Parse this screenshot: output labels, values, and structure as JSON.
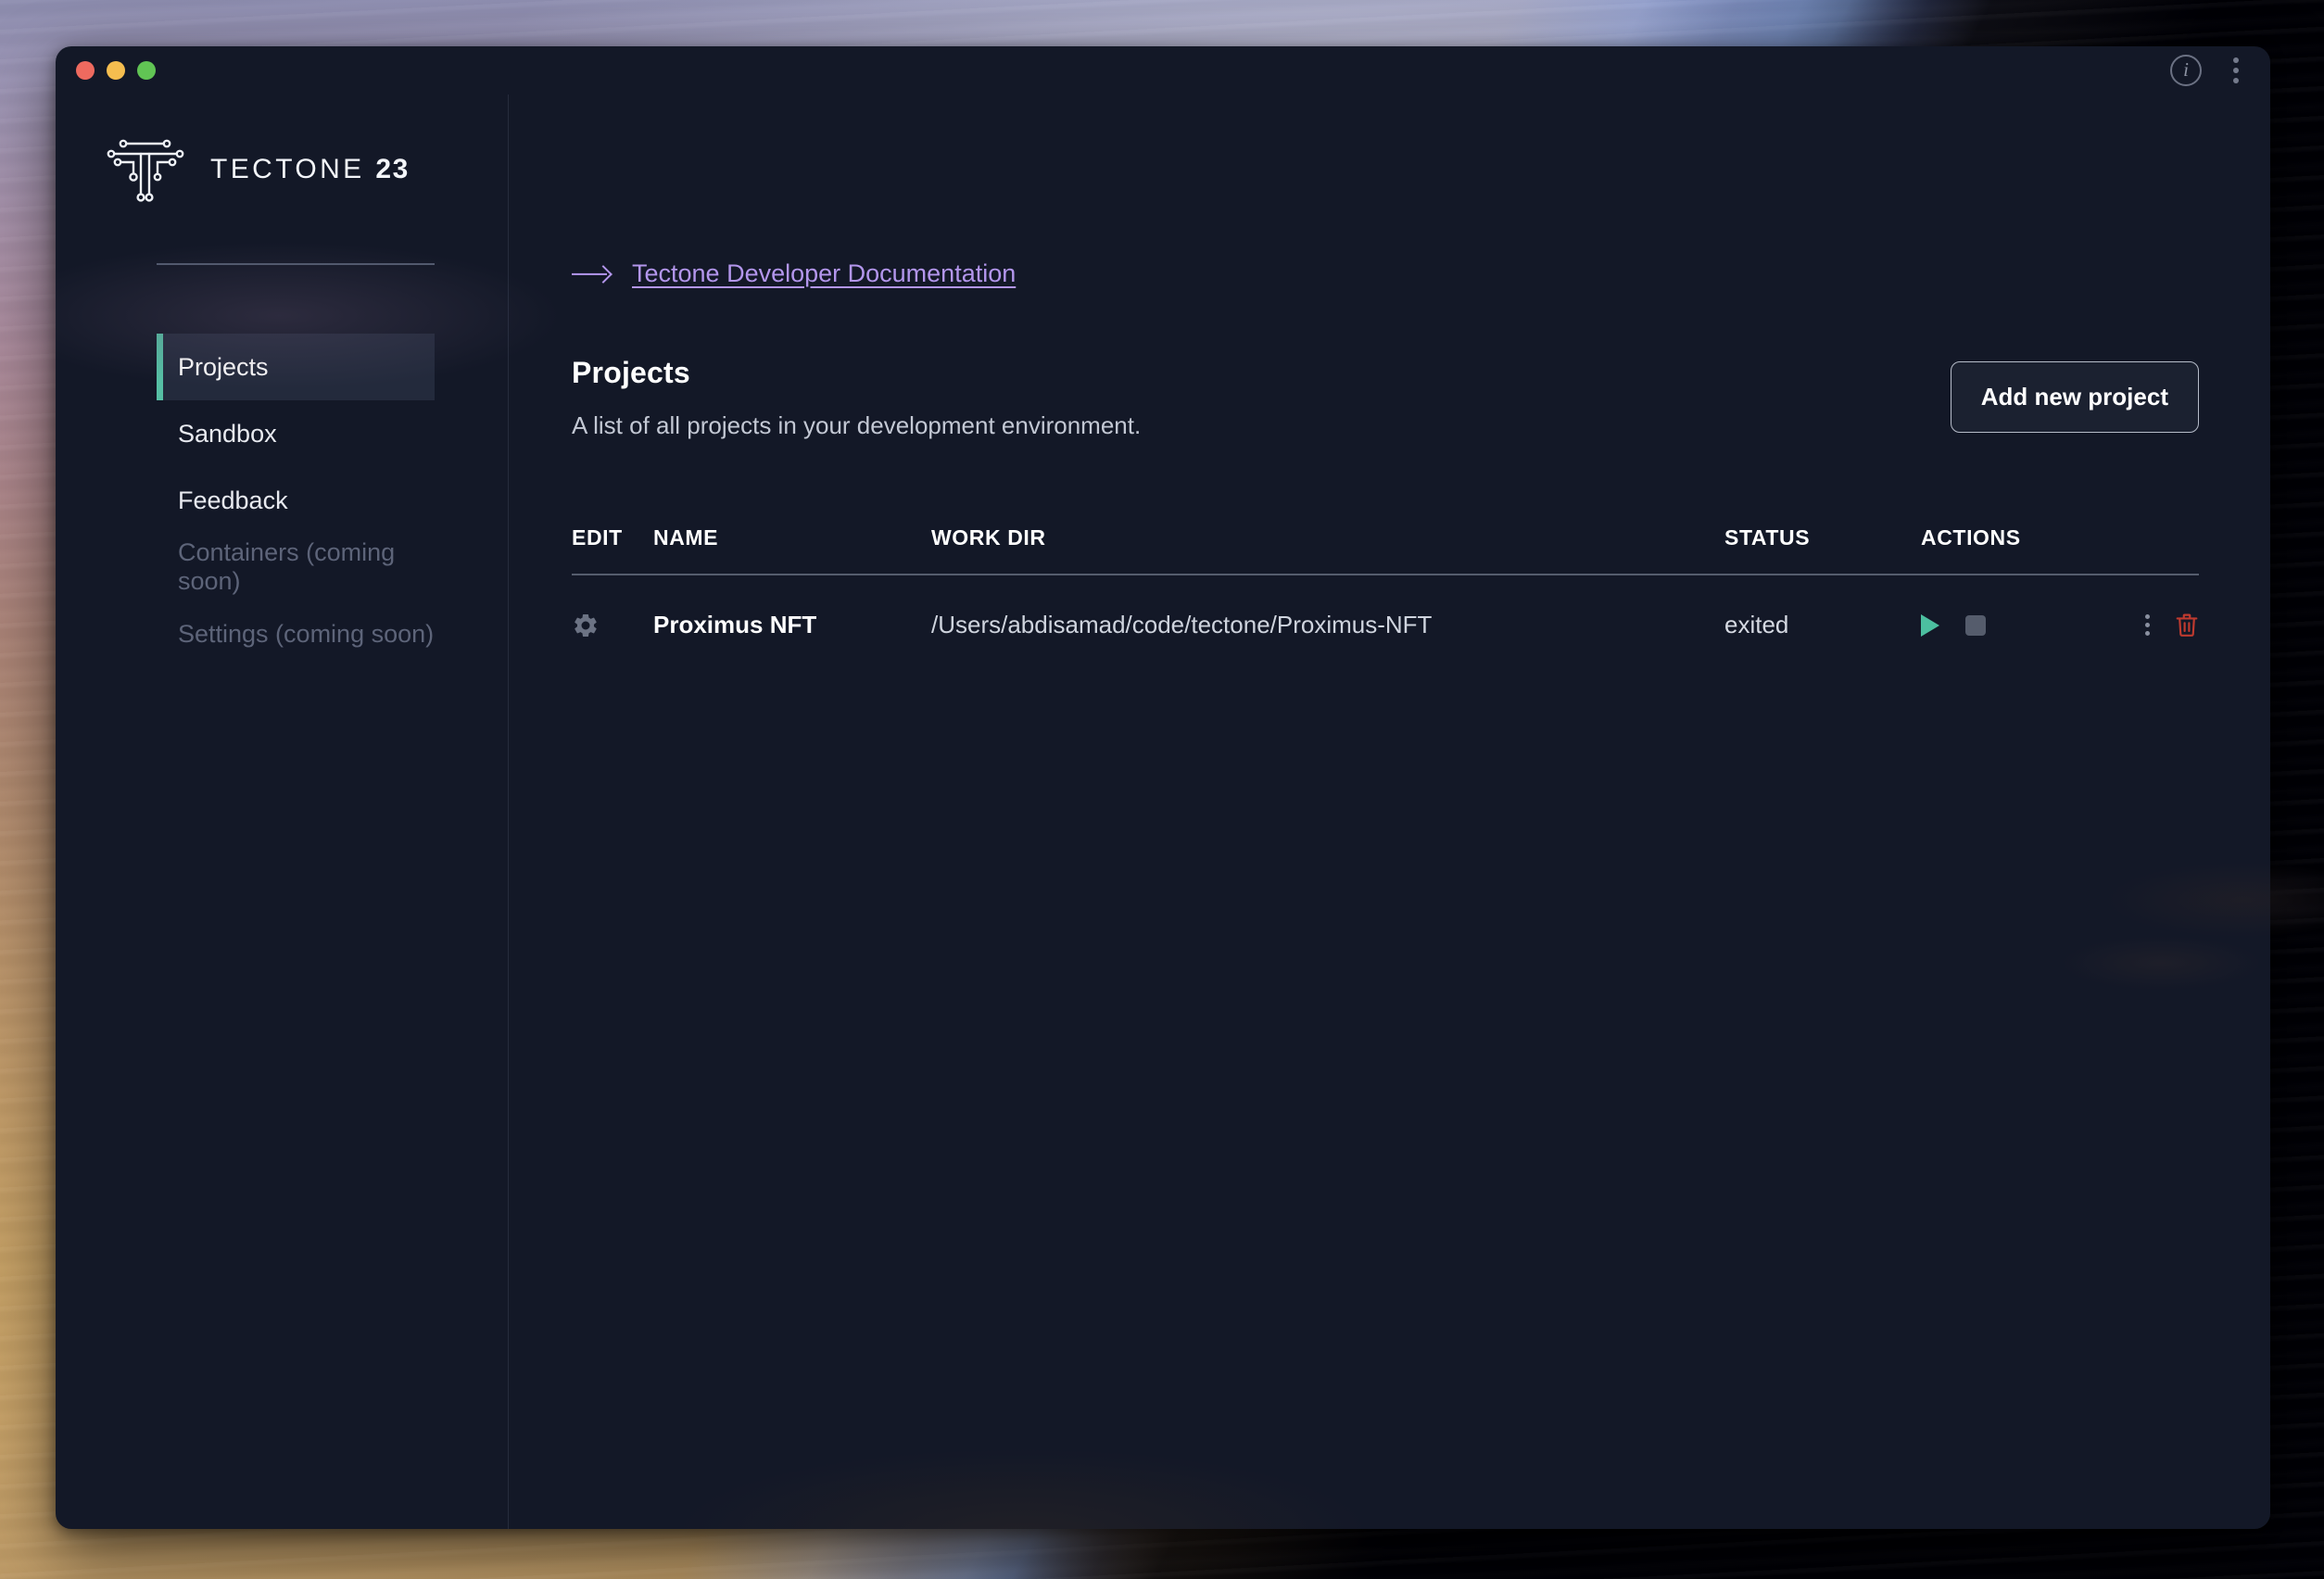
{
  "window": {
    "traffic_lights": [
      "close",
      "minimize",
      "zoom"
    ],
    "info_icon_glyph": "i",
    "colors": {
      "close": "#ee6a5f",
      "minimize": "#f5bd4f",
      "zoom": "#61c454",
      "accent_teal": "#56bfa4",
      "link_purple": "#b396ec",
      "danger_red": "#c0392b",
      "window_bg": "#131827"
    }
  },
  "sidebar": {
    "brand": {
      "name": "TECTONE",
      "number": "23",
      "logo_icon": "tectone-circuit-t-logo"
    },
    "items": [
      {
        "label": "Projects",
        "state": "active"
      },
      {
        "label": "Sandbox",
        "state": "default"
      },
      {
        "label": "Feedback",
        "state": "default"
      },
      {
        "label": "Containers (coming soon)",
        "state": "disabled"
      },
      {
        "label": "Settings (coming soon)",
        "state": "disabled"
      }
    ]
  },
  "main": {
    "doc_link": {
      "label": "Tectone Developer Documentation",
      "arrow_icon": "arrow-right-icon"
    },
    "page_title": "Projects",
    "page_subtitle": "A list of all projects in your development environment.",
    "add_button_label": "Add new project",
    "table": {
      "headers": [
        "EDIT",
        "NAME",
        "WORK DIR",
        "STATUS",
        "ACTIONS"
      ],
      "rows": [
        {
          "edit_icon": "gear-icon",
          "name": "Proximus NFT",
          "work_dir": "/Users/abdisamad/code/tectone/Proximus-NFT",
          "status": "exited",
          "actions": [
            "play-icon",
            "stop-icon",
            "kebab-menu-icon",
            "trash-icon"
          ]
        }
      ]
    }
  }
}
